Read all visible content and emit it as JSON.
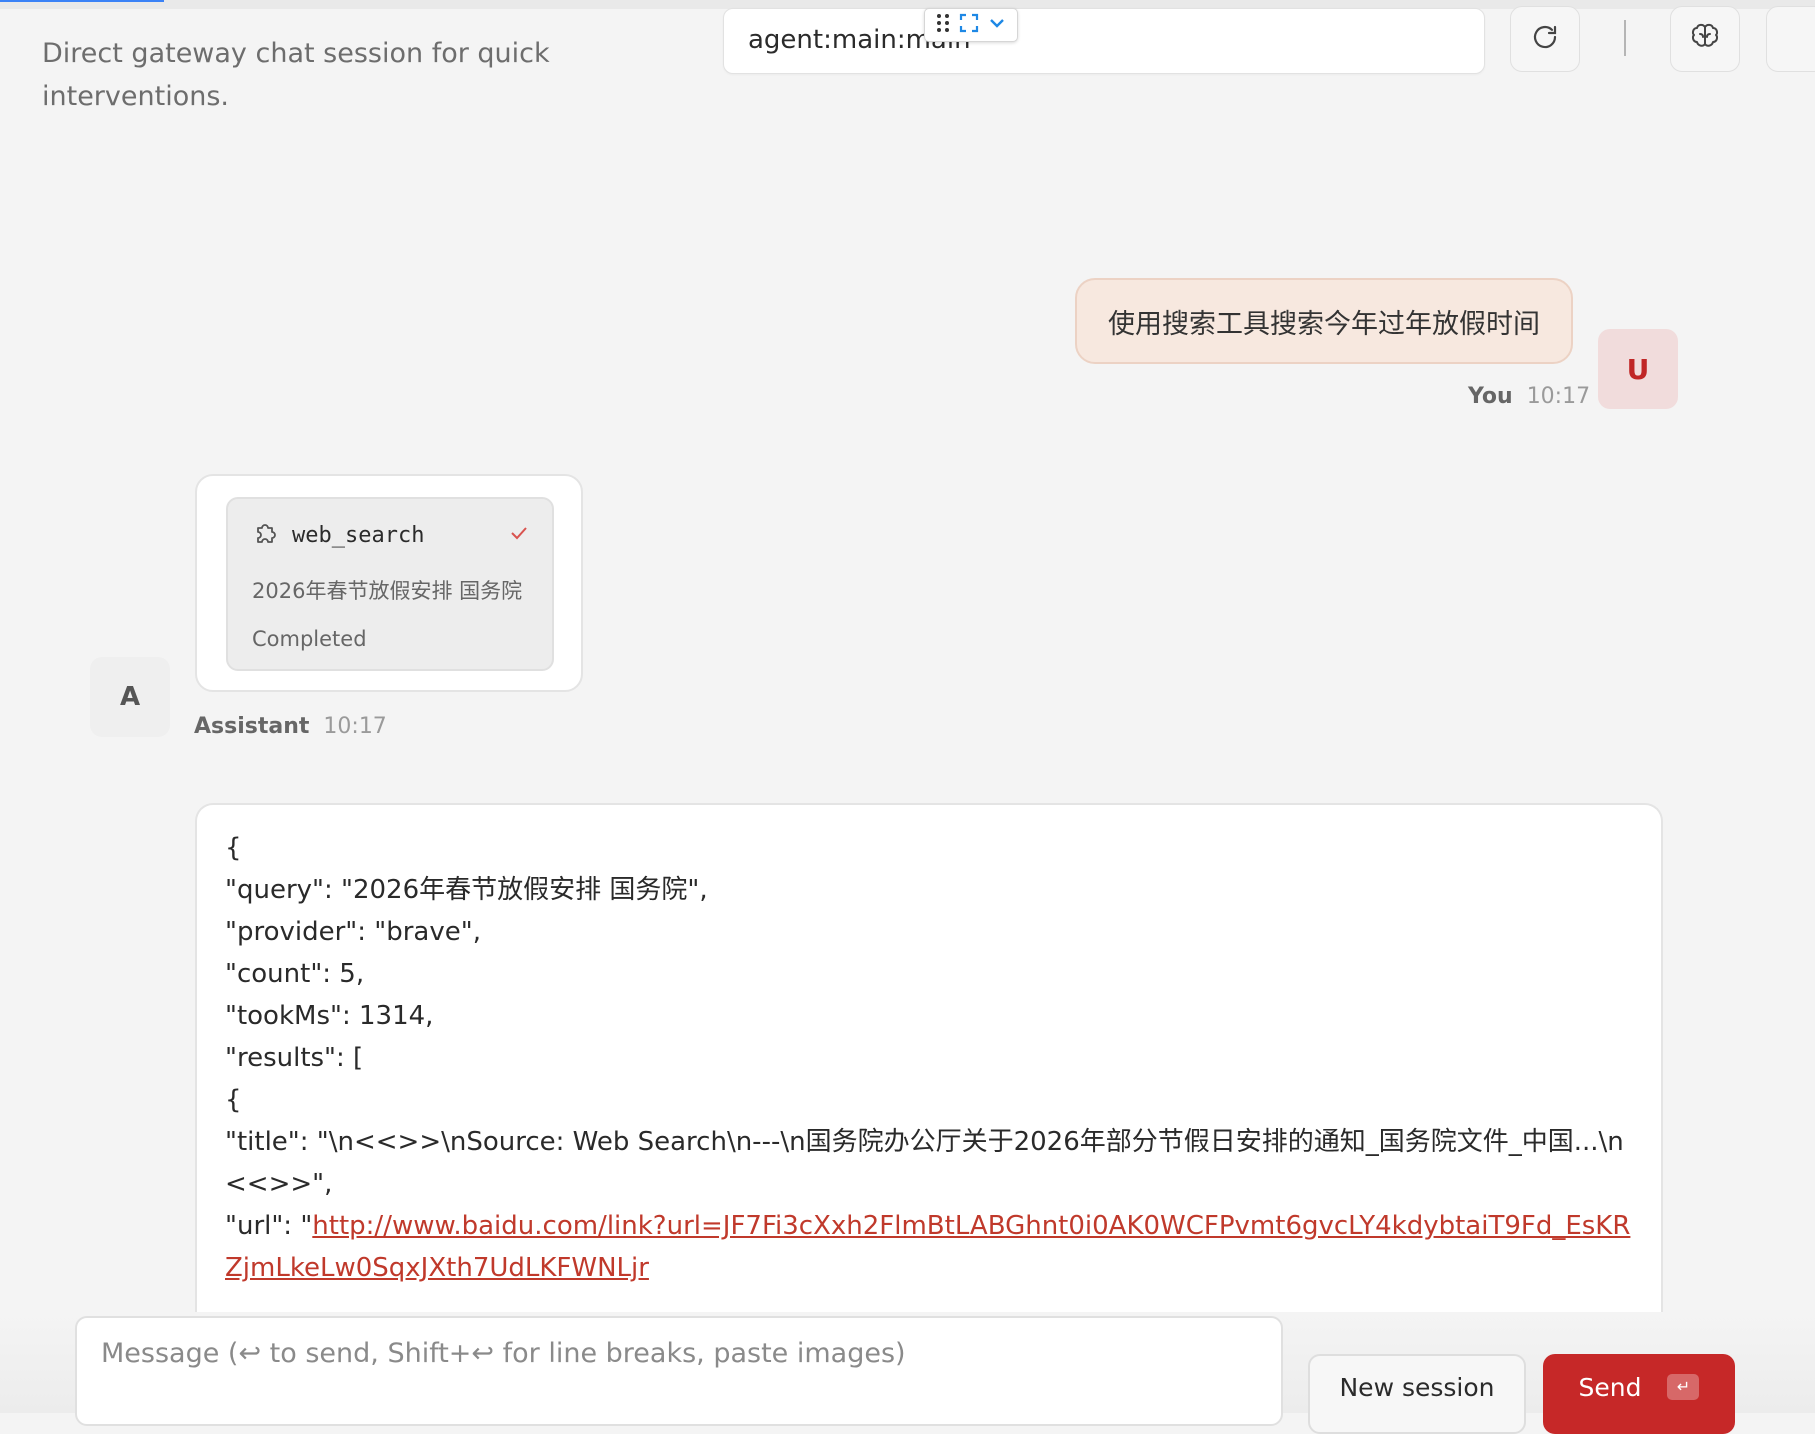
{
  "header": {
    "subtitle": "Direct gateway chat session for quick interventions.",
    "session_value": "agent:main:main"
  },
  "icons": {
    "refresh": "refresh-icon",
    "brain": "brain-icon",
    "grip": "grip-icon",
    "fullscreen": "fullscreen-icon",
    "chevron": "chevron-down-icon"
  },
  "messages": {
    "user": {
      "text": "使用搜索工具搜索今年过年放假时间",
      "sender": "You",
      "time": "10:17",
      "avatar": "U"
    },
    "assistant": {
      "sender": "Assistant",
      "time": "10:17",
      "avatar": "A",
      "tool": {
        "name": "web_search",
        "query": "2026年春节放假安排 国务院",
        "status": "Completed"
      },
      "json_lines": [
        "{",
        "\"query\": \"2026年春节放假安排 国务院\",",
        "\"provider\": \"brave\",",
        "\"count\": 5,",
        "\"tookMs\": 1314,",
        "\"results\": [",
        "{"
      ],
      "title_line": "\"title\": \"\\n<<>>\\nSource: Web Search\\n---\\n国务院办公厅关于2026年部分节假日安排的通知_国务院文件_中国...\\n<<>>\",",
      "url_prefix": "\"url\": \"",
      "url_link": "http://www.baidu.com/link?url=JF7Fi3cXxh2FlmBtLABGhnt0i0AK0WCFPvmt6gvcLY4kdybtaiT9Fd_EsKRZjmLkeLw0SqxJXth7UdLKFWNLjr"
    }
  },
  "composer": {
    "placeholder": "Message (↩ to send, Shift+↩ for line breaks, paste images)",
    "new_session": "New session",
    "send": "Send",
    "send_key": "↵"
  },
  "colors": {
    "accent": "#c62828",
    "link": "#c0392b",
    "progress": "#3b82f6"
  }
}
